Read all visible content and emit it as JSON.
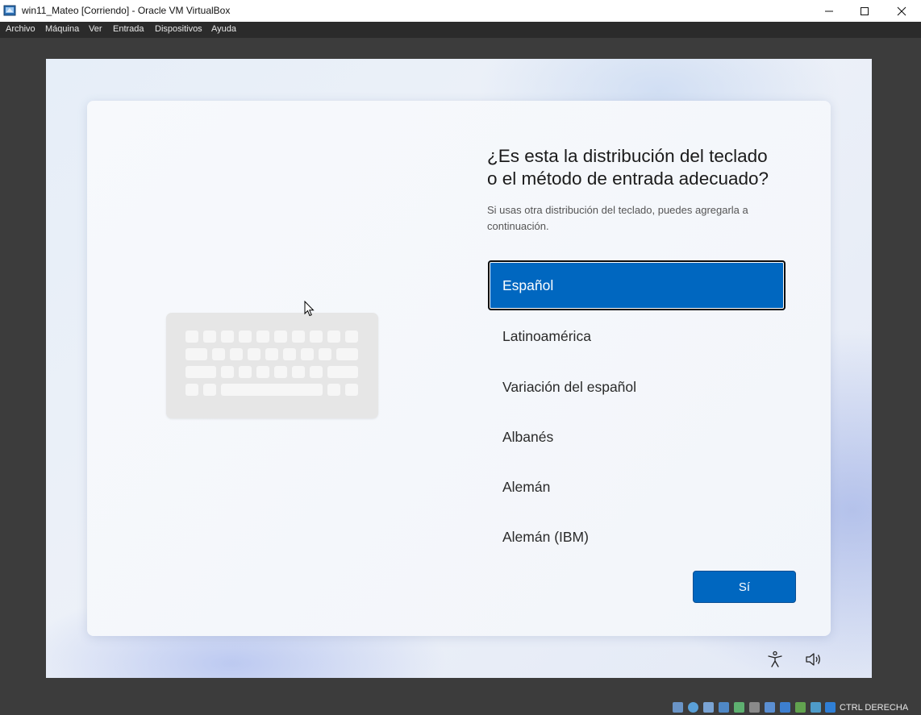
{
  "window": {
    "title": "win11_Mateo [Corriendo] - Oracle VM VirtualBox"
  },
  "menu": {
    "items": [
      "Archivo",
      "Máquina",
      "Ver",
      "Entrada",
      "Dispositivos",
      "Ayuda"
    ]
  },
  "oobe": {
    "heading_line1": "¿Es esta la distribución del teclado",
    "heading_line2": "o el método de entrada adecuado?",
    "subtext": "Si usas otra distribución del teclado, puedes agregarla a continuación.",
    "options": [
      "Español",
      "Latinoamérica",
      "Variación del español",
      "Albanés",
      "Alemán",
      "Alemán (IBM)"
    ],
    "selected_option": "Español",
    "yes_label": "Sí"
  },
  "statusbar": {
    "host_key_label": "CTRL DERECHA",
    "icons": [
      "hard-disk-icon",
      "optical-drive-icon",
      "audio-icon",
      "network-icon",
      "usb-icon",
      "shared-folders-icon",
      "display-icon",
      "video-capture-icon",
      "recording-icon",
      "mouse-integration-icon",
      "keyboard-capture-icon"
    ]
  },
  "colors": {
    "accent": "#0067c0",
    "menubar": "#2b2b2b",
    "frame": "#3c3c3c"
  }
}
